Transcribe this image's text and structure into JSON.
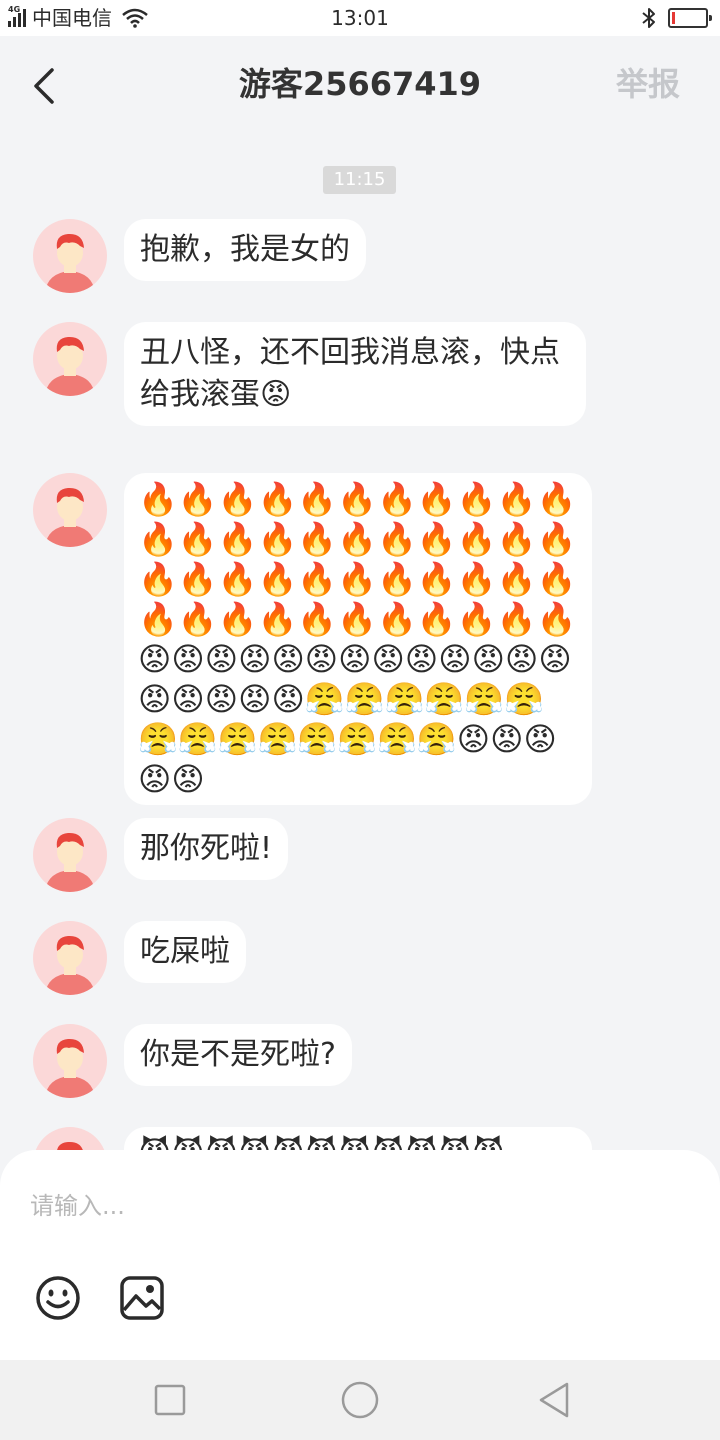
{
  "status_bar": {
    "network_tag": "4G",
    "carrier": "中国电信",
    "time": "13:01",
    "bluetooth_icon": "bluetooth-icon",
    "battery_level": 0.08
  },
  "header": {
    "title": "游客25667419",
    "report": "举报",
    "back_icon": "chevron-left-icon"
  },
  "timestamp": "11:15",
  "messages": [
    {
      "text": "抱歉，我是女的"
    },
    {
      "text": "丑八怪，还不回我消息滚，快点给我滚蛋😡"
    },
    {
      "text": "🔥🔥🔥🔥🔥🔥🔥🔥🔥🔥🔥🔥🔥🔥🔥🔥🔥🔥🔥🔥🔥🔥🔥🔥🔥🔥🔥🔥🔥🔥🔥🔥🔥🔥🔥🔥🔥🔥🔥🔥🔥🔥🔥🔥😡😡😡😡😡😡😡😡😡😡😡😡😡😡😡😡😡😡😤😤😤😤😤😤😤😤😤😤😤😤😤😤😡😡😡😡😡"
    },
    {
      "text": "那你死啦!"
    },
    {
      "text": "吃屎啦"
    },
    {
      "text": "你是不是死啦?"
    },
    {
      "text": "😈😈😈😈😈😈😈😈😈😈😈"
    }
  ],
  "input": {
    "placeholder": "请输入..."
  },
  "colors": {
    "background": "#f3f4f6",
    "bubble": "#ffffff",
    "avatar_bg": "#fbd8d8",
    "avatar_hair": "#e8453c",
    "report_disabled": "#c5c7cb"
  }
}
